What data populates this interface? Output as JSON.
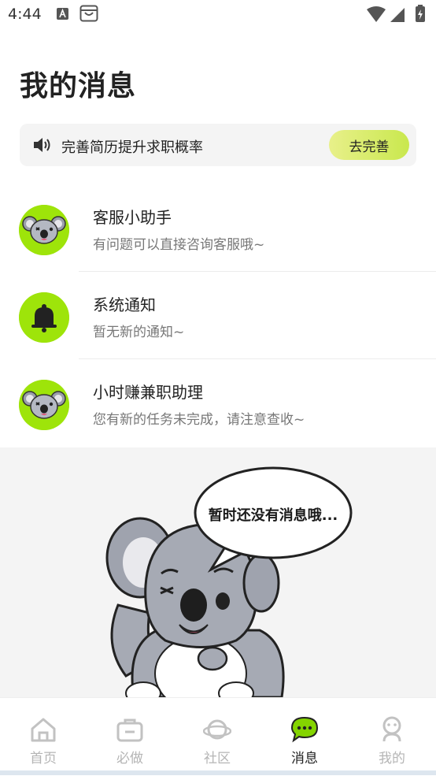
{
  "status_bar": {
    "time": "4:44"
  },
  "header": {
    "title": "我的消息"
  },
  "banner": {
    "text": "完善简历提升求职概率",
    "button_label": "去完善"
  },
  "messages": [
    {
      "title": "客服小助手",
      "subtitle": "有问题可以直接咨询客服哦~",
      "avatar": "koala-icon"
    },
    {
      "title": "系统通知",
      "subtitle": "暂无新的通知~",
      "avatar": "bell-icon"
    },
    {
      "title": "小时赚兼职助理",
      "subtitle": "您有新的任务未完成，请注意查收~",
      "avatar": "koala-icon"
    }
  ],
  "empty_state": {
    "bubble_text": "暂时还没有消息哦..."
  },
  "tabbar": {
    "items": [
      {
        "label": "首页",
        "icon": "home-icon",
        "active": false
      },
      {
        "label": "必做",
        "icon": "briefcase-icon",
        "active": false
      },
      {
        "label": "社区",
        "icon": "planet-icon",
        "active": false
      },
      {
        "label": "消息",
        "icon": "chat-icon",
        "active": true
      },
      {
        "label": "我的",
        "icon": "person-icon",
        "active": false
      }
    ]
  },
  "colors": {
    "accent": "#9ee40a",
    "button_gradient_start": "#e8f08a",
    "button_gradient_end": "#c9e84e",
    "active_tab": "#84d400"
  }
}
